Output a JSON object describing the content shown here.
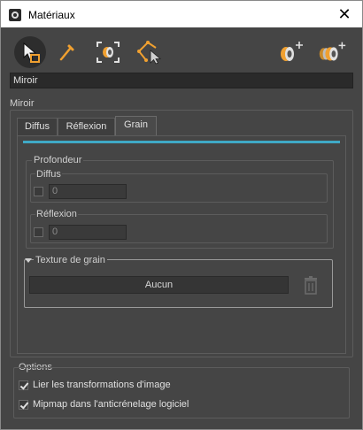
{
  "window": {
    "title": "Matériaux",
    "close_glyph": "✕"
  },
  "toolbar": {
    "icons": [
      "cursor-pick-icon",
      "eyedropper-icon",
      "frame-material-icon",
      "select-polygon-icon",
      "new-material-icon",
      "duplicate-material-icon"
    ]
  },
  "material": {
    "name": "Miroir"
  },
  "group": {
    "label": "Miroir"
  },
  "tabs": [
    {
      "label": "Diffus",
      "selected": false
    },
    {
      "label": "Réflexion",
      "selected": false
    },
    {
      "label": "Grain",
      "selected": true
    }
  ],
  "accent_color": "#3fa9c6",
  "grain": {
    "depth_label": "Profondeur",
    "diffuse": {
      "label": "Diffus",
      "checked": false,
      "value": "0"
    },
    "reflection": {
      "label": "Réflexion",
      "checked": false,
      "value": "0"
    },
    "texture": {
      "label": "Texture de grain",
      "button_label": "Aucun"
    }
  },
  "options": {
    "label": "Options",
    "items": [
      {
        "label": "Lier les transformations d'image",
        "checked": true
      },
      {
        "label": "Mipmap dans l'anticrénelage logiciel",
        "checked": true
      }
    ]
  }
}
